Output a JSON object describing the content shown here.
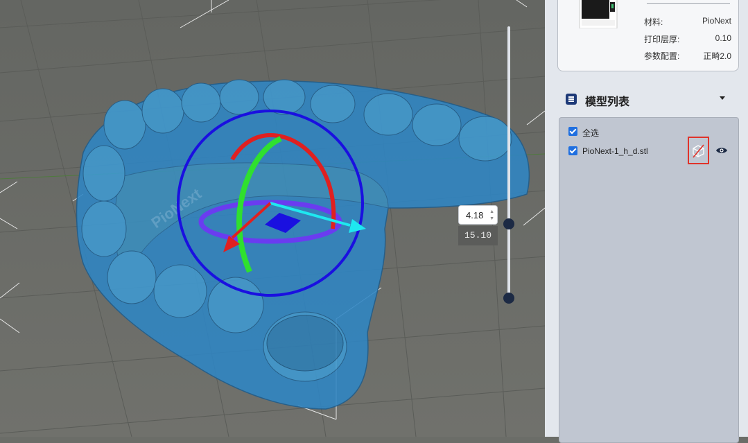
{
  "printer": {
    "specs": [
      {
        "label": "材料:",
        "value": "PioNext"
      },
      {
        "label": "打印层厚:",
        "value": "0.10"
      },
      {
        "label": "参数配置:",
        "value": "正畸2.0"
      }
    ]
  },
  "model_list": {
    "title": "模型列表",
    "select_all_label": "全选",
    "items": [
      {
        "name": "PioNext-1_h_d.stl",
        "checked": true,
        "visible": true
      }
    ]
  },
  "layer_slider": {
    "current_value": "4.18",
    "max_value": "15.10"
  },
  "viewport": {
    "model_watermark": "PioNext"
  }
}
